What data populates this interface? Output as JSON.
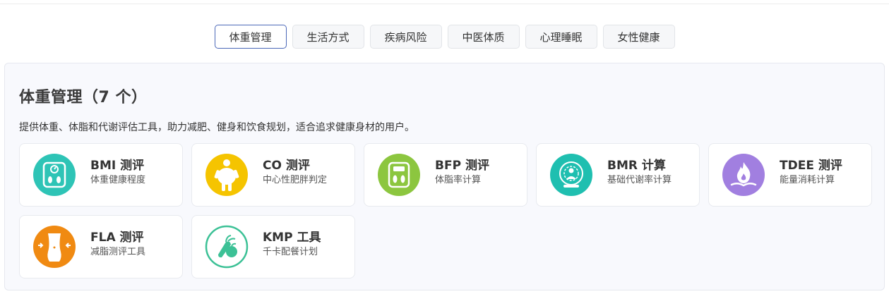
{
  "tabs": [
    {
      "label": "体重管理",
      "active": true
    },
    {
      "label": "生活方式",
      "active": false
    },
    {
      "label": "疾病风险",
      "active": false
    },
    {
      "label": "中医体质",
      "active": false
    },
    {
      "label": "心理睡眠",
      "active": false
    },
    {
      "label": "女性健康",
      "active": false
    }
  ],
  "section": {
    "title": "体重管理（7 个）",
    "description": "提供体重、体脂和代谢评估工具，助力减肥、健身和饮食规划，适合追求健康身材的用户。"
  },
  "cards": [
    {
      "title": "BMI 测评",
      "subtitle": "体重健康程度",
      "icon": "bmi-scale-icon",
      "color": "#2ec4b6"
    },
    {
      "title": "CO 测评",
      "subtitle": "中心性肥胖判定",
      "icon": "obesity-figure-icon",
      "color": "#f5c400"
    },
    {
      "title": "BFP 测评",
      "subtitle": "体脂率计算",
      "icon": "body-fat-scale-icon",
      "color": "#8cc63f"
    },
    {
      "title": "BMR 计算",
      "subtitle": "基础代谢率计算",
      "icon": "metabolism-icon",
      "color": "#1fbfb0"
    },
    {
      "title": "TDEE 测评",
      "subtitle": "能量消耗计算",
      "icon": "energy-flame-icon",
      "color": "#a17fe0"
    },
    {
      "title": "FLA 测评",
      "subtitle": "减脂测评工具",
      "icon": "waist-icon",
      "color": "#f08a12"
    },
    {
      "title": "KMP 工具",
      "subtitle": "千卡配餐计划",
      "icon": "vegetables-icon",
      "color": "#3cc196"
    }
  ]
}
